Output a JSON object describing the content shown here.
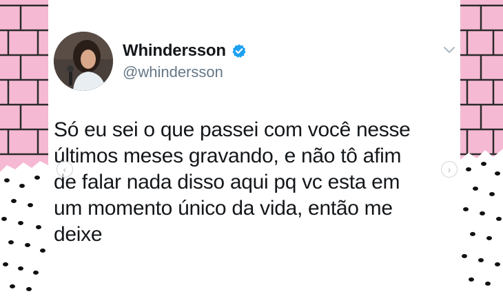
{
  "tweet": {
    "display_name": "Whindersson",
    "handle": "@whindersson",
    "verified": true,
    "text_lines": [
      "Só eu sei o que passei com você nesse",
      "últimos meses gravando, e não tô afim",
      "de falar nada disso aqui pq vc esta em",
      "um momento único da vida, então me",
      "deixe"
    ]
  },
  "icons": {
    "verified": "verified-badge-icon",
    "menu": "chevron-down-icon",
    "prev": "chevron-left-icon",
    "next": "chevron-right-icon"
  },
  "colors": {
    "background_pink": "#f6b9d3",
    "brick_line": "#2a2a2a",
    "verified_blue": "#1da1f2",
    "text": "#14171a",
    "handle": "#657786"
  }
}
